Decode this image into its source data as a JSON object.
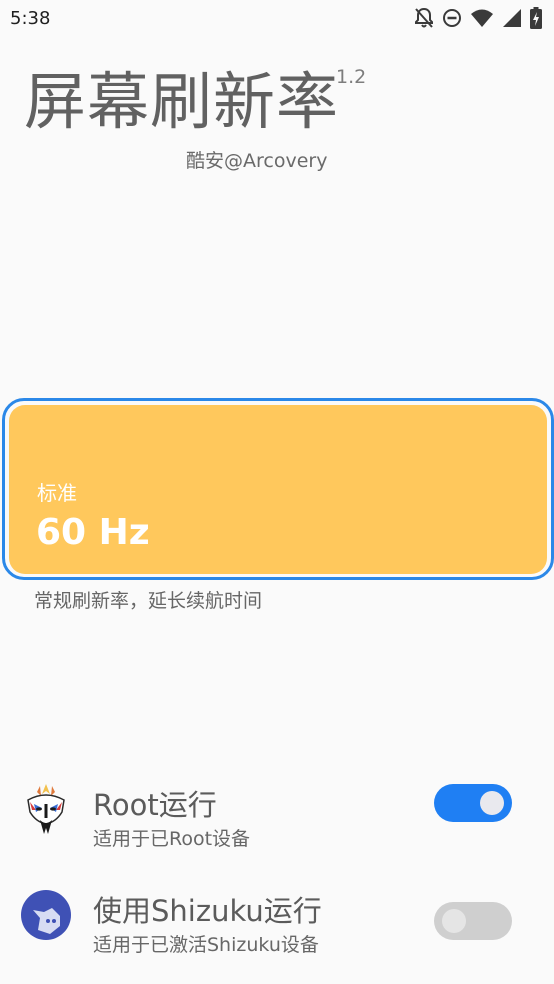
{
  "status_bar": {
    "time": "5:38",
    "icons": [
      "notifications-off-icon",
      "do-not-disturb-icon",
      "wifi-icon",
      "signal-icon",
      "battery-charging-icon"
    ]
  },
  "header": {
    "title": "屏幕刷新率",
    "version": "1.2",
    "author": "酷安@Arcovery"
  },
  "mode": {
    "label": "标准",
    "value": "60 Hz",
    "description": "常规刷新率，延长续航时间",
    "card_color": "#ffc85c",
    "outline_color": "#2b88e8"
  },
  "options": [
    {
      "icon": "magisk-icon",
      "title": "Root运行",
      "subtitle": "适用于已Root设备",
      "enabled": true
    },
    {
      "icon": "shizuku-icon",
      "title": "使用Shizuku运行",
      "subtitle": "适用于已激活Shizuku设备",
      "enabled": false
    }
  ],
  "colors": {
    "switch_on": "#1f7ff3",
    "switch_off": "#cfcfcf"
  }
}
